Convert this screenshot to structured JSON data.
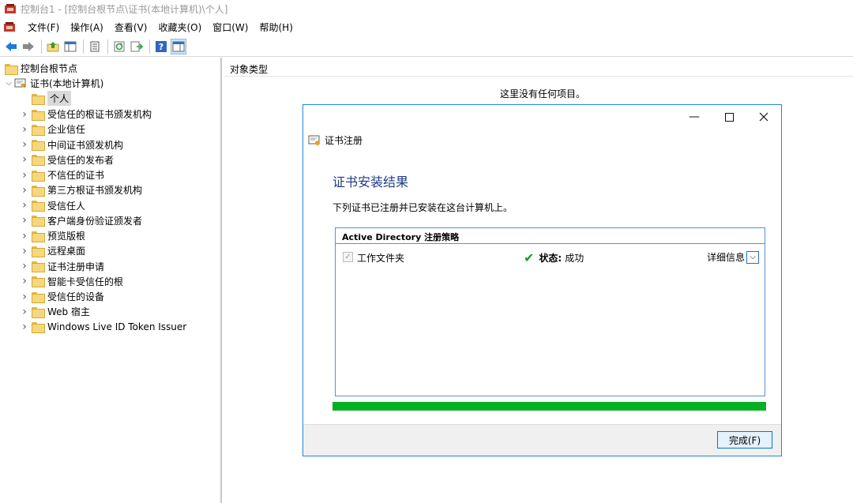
{
  "window": {
    "title": "控制台1 - [控制台根节点\\证书(本地计算机)\\个人]"
  },
  "menu": {
    "items": [
      "文件(F)",
      "操作(A)",
      "查看(V)",
      "收藏夹(O)",
      "窗口(W)",
      "帮助(H)"
    ]
  },
  "toolbar": {
    "icons": [
      "back-arrow-icon",
      "forward-arrow-icon",
      "up-folder-icon",
      "show-hide-tree-icon",
      "properties-icon",
      "refresh-icon",
      "export-list-icon",
      "help-icon",
      "show-action-pane-icon"
    ]
  },
  "tree": {
    "root": "控制台根节点",
    "cert_store": "证书(本地计算机)",
    "selected": "个人",
    "children": [
      "受信任的根证书颁发机构",
      "企业信任",
      "中间证书颁发机构",
      "受信任的发布者",
      "不信任的证书",
      "第三方根证书颁发机构",
      "受信任人",
      "客户端身份验证颁发者",
      "预览版根",
      "远程桌面",
      "证书注册申请",
      "智能卡受信任的根",
      "受信任的设备",
      "Web 宿主",
      "Windows Live ID Token Issuer"
    ]
  },
  "content": {
    "column_header": "对象类型",
    "empty_message": "这里没有任何项目。"
  },
  "dialog": {
    "title": "证书注册",
    "heading": "证书安装结果",
    "description": "下列证书已注册并已安装在这台计算机上。",
    "policy_header": "Active Directory 注册策略",
    "row": {
      "checkbox_label": "工作文件夹",
      "status_label": "状态:",
      "status_value": "成功",
      "details_label": "详细信息"
    },
    "progress": 1.0,
    "finish_button": "完成(F)"
  },
  "colors": {
    "accent": "#1e88e5",
    "progress": "#06b025",
    "heading": "#1f3c88"
  }
}
